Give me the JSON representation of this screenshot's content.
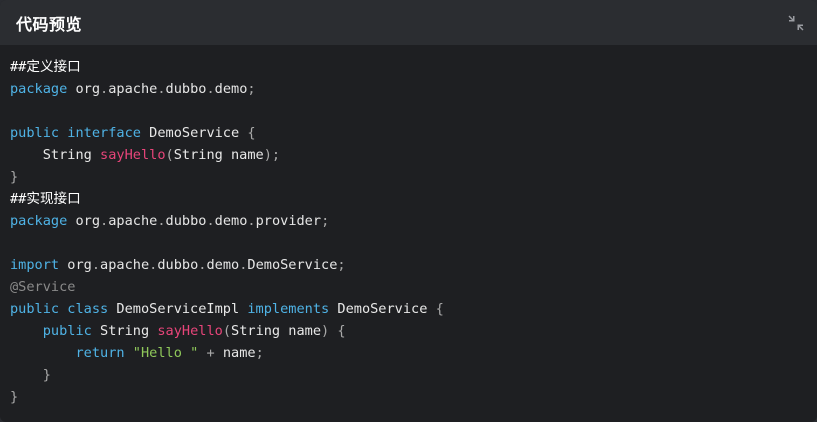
{
  "header": {
    "title": "代码预览",
    "collapse_icon": "collapse-arrows-icon"
  },
  "code_lines": [
    [
      {
        "t": "##定义接口",
        "c": "c-comment"
      }
    ],
    [
      {
        "t": "package",
        "c": "c-kw"
      },
      {
        "t": " org",
        "c": "c-plain"
      },
      {
        "t": ".",
        "c": "c-punct"
      },
      {
        "t": "apache",
        "c": "c-plain"
      },
      {
        "t": ".",
        "c": "c-punct"
      },
      {
        "t": "dubbo",
        "c": "c-plain"
      },
      {
        "t": ".",
        "c": "c-punct"
      },
      {
        "t": "demo",
        "c": "c-plain"
      },
      {
        "t": ";",
        "c": "c-punct"
      }
    ],
    [],
    [
      {
        "t": "public",
        "c": "c-kw"
      },
      {
        "t": " ",
        "c": "c-plain"
      },
      {
        "t": "interface",
        "c": "c-kw"
      },
      {
        "t": " DemoService ",
        "c": "c-type"
      },
      {
        "t": "{",
        "c": "c-punct"
      }
    ],
    [
      {
        "t": "    String ",
        "c": "c-type"
      },
      {
        "t": "sayHello",
        "c": "c-fn"
      },
      {
        "t": "(",
        "c": "c-punct"
      },
      {
        "t": "String name",
        "c": "c-type"
      },
      {
        "t": ");",
        "c": "c-punct"
      }
    ],
    [
      {
        "t": "}",
        "c": "c-punct"
      }
    ],
    [
      {
        "t": "##实现接口",
        "c": "c-comment"
      }
    ],
    [
      {
        "t": "package",
        "c": "c-kw"
      },
      {
        "t": " org",
        "c": "c-plain"
      },
      {
        "t": ".",
        "c": "c-punct"
      },
      {
        "t": "apache",
        "c": "c-plain"
      },
      {
        "t": ".",
        "c": "c-punct"
      },
      {
        "t": "dubbo",
        "c": "c-plain"
      },
      {
        "t": ".",
        "c": "c-punct"
      },
      {
        "t": "demo",
        "c": "c-plain"
      },
      {
        "t": ".",
        "c": "c-punct"
      },
      {
        "t": "provider",
        "c": "c-plain"
      },
      {
        "t": ";",
        "c": "c-punct"
      }
    ],
    [],
    [
      {
        "t": "import",
        "c": "c-kw"
      },
      {
        "t": " org",
        "c": "c-plain"
      },
      {
        "t": ".",
        "c": "c-punct"
      },
      {
        "t": "apache",
        "c": "c-plain"
      },
      {
        "t": ".",
        "c": "c-punct"
      },
      {
        "t": "dubbo",
        "c": "c-plain"
      },
      {
        "t": ".",
        "c": "c-punct"
      },
      {
        "t": "demo",
        "c": "c-plain"
      },
      {
        "t": ".",
        "c": "c-punct"
      },
      {
        "t": "DemoService",
        "c": "c-plain"
      },
      {
        "t": ";",
        "c": "c-punct"
      }
    ],
    [
      {
        "t": "@Service",
        "c": "c-anno"
      }
    ],
    [
      {
        "t": "public",
        "c": "c-kw"
      },
      {
        "t": " ",
        "c": "c-plain"
      },
      {
        "t": "class",
        "c": "c-kw"
      },
      {
        "t": " DemoServiceImpl ",
        "c": "c-type"
      },
      {
        "t": "implements",
        "c": "c-kw"
      },
      {
        "t": " DemoService ",
        "c": "c-type"
      },
      {
        "t": "{",
        "c": "c-punct"
      }
    ],
    [
      {
        "t": "    ",
        "c": "c-plain"
      },
      {
        "t": "public",
        "c": "c-kw"
      },
      {
        "t": " String ",
        "c": "c-type"
      },
      {
        "t": "sayHello",
        "c": "c-fn"
      },
      {
        "t": "(",
        "c": "c-punct"
      },
      {
        "t": "String name",
        "c": "c-type"
      },
      {
        "t": ") {",
        "c": "c-punct"
      }
    ],
    [
      {
        "t": "        ",
        "c": "c-plain"
      },
      {
        "t": "return",
        "c": "c-kw"
      },
      {
        "t": " ",
        "c": "c-plain"
      },
      {
        "t": "\"Hello \"",
        "c": "c-str"
      },
      {
        "t": " + ",
        "c": "c-punct"
      },
      {
        "t": "name",
        "c": "c-plain"
      },
      {
        "t": ";",
        "c": "c-punct"
      }
    ],
    [
      {
        "t": "    }",
        "c": "c-punct"
      }
    ],
    [
      {
        "t": "}",
        "c": "c-punct"
      }
    ]
  ]
}
